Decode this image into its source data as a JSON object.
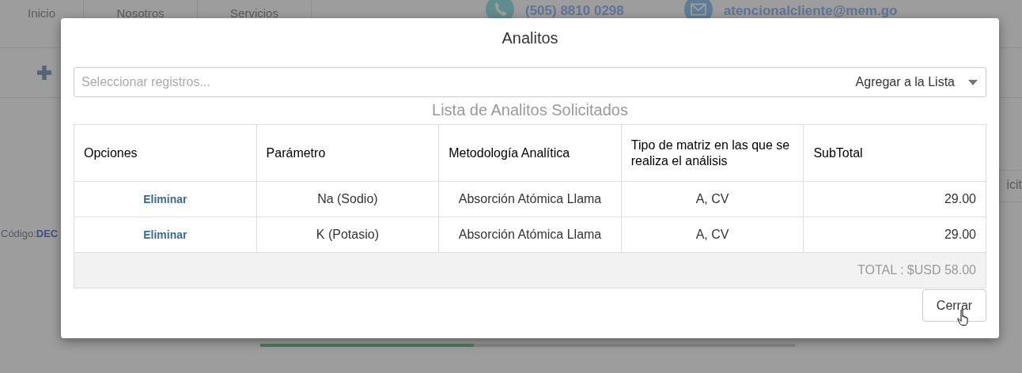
{
  "background_page": {
    "nav": [
      {
        "label": "Inicio"
      },
      {
        "label": "Nosotros"
      },
      {
        "label": "Servicios"
      }
    ],
    "phone": "(505) 8810 0298",
    "email": "atencionalcliente@mem.go",
    "code_label": "Código:",
    "code_value": "DEC",
    "side_button": "icit",
    "progress": {
      "level": 0.4
    }
  },
  "modal": {
    "title": "Analitos",
    "select": {
      "placeholder": "Seleccionar registros...",
      "action": "Agregar a la Lista"
    },
    "subtitle": "Lista de Analitos Solicitados",
    "table": {
      "columns": [
        "Opciones",
        "Parámetro",
        "Metodología Analítica",
        "Tipo de matriz en las que se realiza el análisis",
        "SubTotal"
      ],
      "rows": [
        {
          "action": "Eliminar",
          "parameter": "Na (Sodio)",
          "method": "Absorción Atómica Llama",
          "matrix": "A, CV",
          "subtotal": "29.00"
        },
        {
          "action": "Eliminar",
          "parameter": "K (Potasio)",
          "method": "Absorción Atómica Llama",
          "matrix": "A, CV",
          "subtotal": "29.00"
        }
      ],
      "total": "TOTAL : $USD 58.00"
    },
    "close_button": "Cerrar"
  }
}
